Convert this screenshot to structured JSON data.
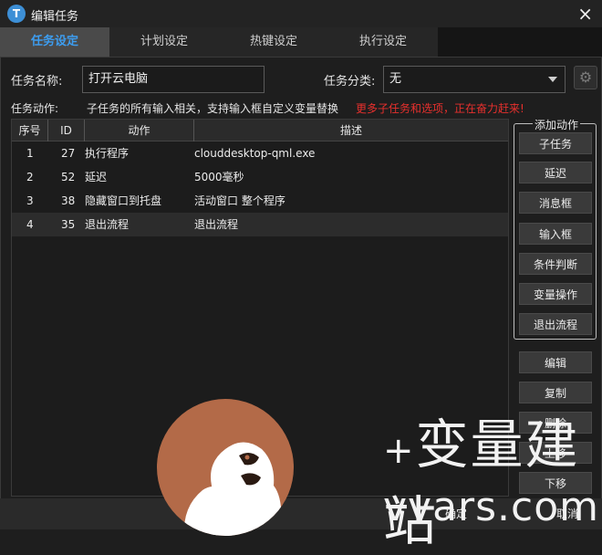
{
  "window": {
    "title": "编辑任务",
    "close_icon": "×",
    "icon_letter": "T"
  },
  "tabs": [
    {
      "label": "任务设定",
      "active": true
    },
    {
      "label": "计划设定",
      "active": false
    },
    {
      "label": "热键设定",
      "active": false
    },
    {
      "label": "执行设定",
      "active": false
    }
  ],
  "form": {
    "name_label": "任务名称:",
    "name_value": "打开云电脑",
    "category_label": "任务分类:",
    "category_value": "无",
    "actions_label": "任务动作:",
    "hint": "子任务的所有输入相关，支持输入框自定义变量替换",
    "hint_red": "更多子任务和选项，正在奋力赶来!"
  },
  "table": {
    "headers": [
      "序号",
      "ID",
      "动作",
      "描述"
    ],
    "rows": [
      {
        "seq": "1",
        "id": "27",
        "action": "执行程序",
        "desc": "clouddesktop-qml.exe"
      },
      {
        "seq": "2",
        "id": "52",
        "action": "延迟",
        "desc": "5000毫秒"
      },
      {
        "seq": "3",
        "id": "38",
        "action": "隐藏窗口到托盘",
        "desc": "活动窗口 整个程序"
      },
      {
        "seq": "4",
        "id": "35",
        "action": "退出流程",
        "desc": "退出流程"
      }
    ]
  },
  "add_actions": {
    "title": "添加动作",
    "buttons": [
      "子任务",
      "延迟",
      "消息框",
      "输入框",
      "条件判断",
      "变量操作",
      "退出流程"
    ]
  },
  "edit_buttons": [
    "编辑",
    "复制",
    "删除",
    "上移",
    "下移"
  ],
  "footer": {
    "confirm": "确定",
    "cancel": "取消"
  },
  "watermark": {
    "text": "变量建站",
    "plus": "+",
    "url": "vvars.com"
  },
  "colors": {
    "accent": "#3d9df0",
    "warning": "#e8302d",
    "logo_bg": "#b36a48"
  }
}
